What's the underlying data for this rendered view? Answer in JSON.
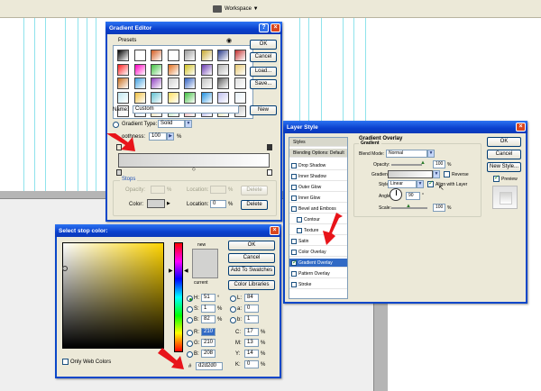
{
  "topbar": {
    "workspace_label": "Workspace ▼"
  },
  "gradient_editor": {
    "title": "Gradient Editor",
    "presets_label": "Presets",
    "ok": "OK",
    "cancel": "Cancel",
    "load": "Load...",
    "save": "Save...",
    "name_label": "Name:",
    "name_value": "Custom",
    "new": "New",
    "gradient_type_label": "Gradient Type:",
    "gradient_type_value": "Solid",
    "smoothness_label": "oothness:",
    "smoothness_value": "100",
    "smoothness_unit": "%",
    "stops_label": "Stops",
    "opacity_label": "Opacity:",
    "opacity_unit": "%",
    "location_label": "Location:",
    "location_unit": "%",
    "delete": "Delete",
    "color_label": "Color:",
    "location2_value": "0",
    "gradient_start_color": "#d2d2d0",
    "gradient_end_color": "#ffffff",
    "preset_swatches": [
      [
        "#000000",
        "#ffffff",
        "#d35b1f",
        "#ffffff",
        "#999999",
        "#c8a830",
        "#2a3c8c",
        "#c33030"
      ],
      [
        "#ff2020",
        "#ff00c0",
        "#40c040",
        "#e07020",
        "#d0c020",
        "#6a3ab0",
        "#b0b0b0",
        "#e8c870"
      ],
      [
        "#c87020",
        "#40a0e0",
        "#9040c0",
        "#d0d0d0",
        "#3060c0",
        "#c0c0c0",
        "#606060",
        "#e0e0e0"
      ],
      [
        "#c0e8f0",
        "#f0c040",
        "#60c0d0",
        "#ffe060",
        "#40c040",
        "#2090e0",
        "#c0c0f0",
        "#e8f0f8"
      ],
      [
        "#f0f0f0",
        "#d0e0f0",
        "#ffd8a0",
        "#b0e0b0",
        "#f0a0a0",
        "#a0a0e0",
        "#e0e0a0",
        "#c0c0c0"
      ]
    ]
  },
  "layer_style": {
    "title": "Layer Style",
    "list": [
      {
        "label": "Styles",
        "type": "hdr"
      },
      {
        "label": "Blending Options: Default",
        "type": "hdr"
      },
      {
        "label": "Drop Shadow",
        "checked": false
      },
      {
        "label": "Inner Shadow",
        "checked": false
      },
      {
        "label": "Outer Glow",
        "checked": false
      },
      {
        "label": "Inner Glow",
        "checked": false
      },
      {
        "label": "Bevel and Emboss",
        "checked": false
      },
      {
        "label": "Contour",
        "checked": false,
        "indent": true
      },
      {
        "label": "Texture",
        "checked": false,
        "indent": true
      },
      {
        "label": "Satin",
        "checked": false
      },
      {
        "label": "Color Overlay",
        "checked": false
      },
      {
        "label": "Gradient Overlay",
        "checked": true,
        "selected": true
      },
      {
        "label": "Pattern Overlay",
        "checked": false
      },
      {
        "label": "Stroke",
        "checked": false
      }
    ],
    "section_title": "Gradient Overlay",
    "sub_title": "Gradient",
    "blend_mode_label": "Blend Mode:",
    "blend_mode_value": "Normal",
    "opacity_label": "Opacity:",
    "opacity_value": "100",
    "opacity_unit": "%",
    "gradient_label": "Gradient:",
    "reverse_label": "Reverse",
    "style_label": "Style:",
    "style_value": "Linear",
    "align_label": "Align with Layer",
    "angle_label": "Angle:",
    "angle_value": "90",
    "angle_unit": "°",
    "scale_label": "Scale:",
    "scale_value": "100",
    "scale_unit": "%",
    "ok": "OK",
    "cancel": "Cancel",
    "new_style": "New Style...",
    "preview": "Preview"
  },
  "color_picker": {
    "title": "Select stop color:",
    "new_label": "new",
    "current_label": "current",
    "ok": "OK",
    "cancel": "Cancel",
    "add_to_swatches": "Add To Swatches",
    "color_libraries": "Color Libraries",
    "h_label": "H:",
    "h_value": "51",
    "h_unit": "°",
    "s_label": "S:",
    "s_value": "1",
    "s_unit": "%",
    "b_label": "B:",
    "b_value": "82",
    "b_unit": "%",
    "r_label": "R:",
    "r_value": "210",
    "g_label": "G:",
    "g_value": "210",
    "b2_label": "B:",
    "b2_value": "208",
    "l_label": "L:",
    "l_value": "84",
    "a_label": "a:",
    "a_value": "0",
    "bb_label": "b:",
    "bb_value": "1",
    "c_label": "C:",
    "c_value": "17",
    "c_unit": "%",
    "m_label": "M:",
    "m_value": "13",
    "m_unit": "%",
    "y_label": "Y:",
    "y_value": "14",
    "y_unit": "%",
    "k_label": "K:",
    "k_value": "0",
    "k_unit": "%",
    "hex_label": "#",
    "hex_value": "d2d2d0",
    "web_colors_label": "Only Web Colors",
    "new_color": "#d2d2d0",
    "hue_color": "#ffd400"
  },
  "arrow_color": "#e8141a"
}
